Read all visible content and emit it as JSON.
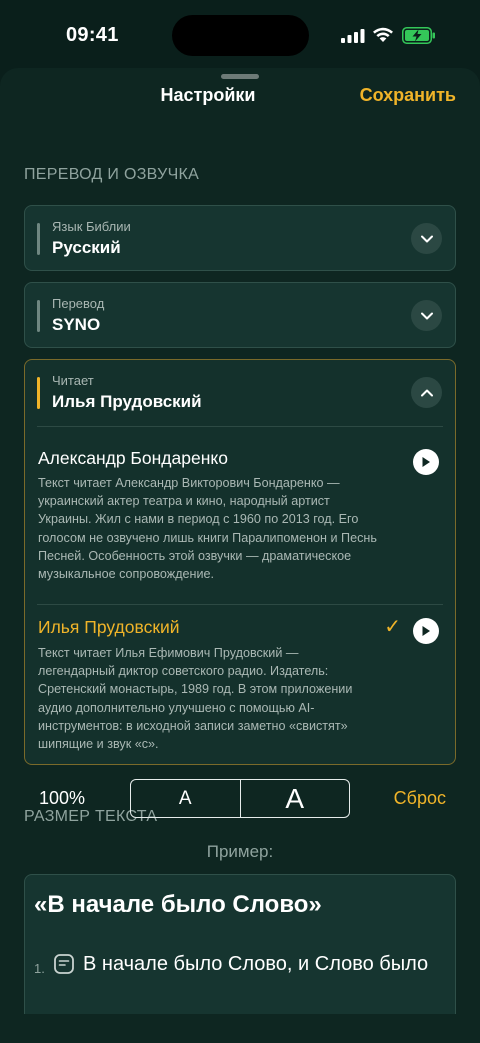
{
  "status": {
    "time": "09:41"
  },
  "header": {
    "title": "Настройки",
    "save_label": "Сохранить"
  },
  "translation_section": {
    "title": "ПЕРЕВОД И ОЗВУЧКА",
    "bible_language": {
      "label": "Язык Библии",
      "value": "Русский"
    },
    "translation": {
      "label": "Перевод",
      "value": "SYNO"
    },
    "reader": {
      "label": "Читает",
      "value": "Илья Прудовский",
      "options": [
        {
          "name": "Александр Бондаренко",
          "description": "Текст читает Александр Викторович Бондаренко — украинский актер театра и кино, народный артист Украины. Жил с нами в период с 1960 по 2013 год. Его голосом не озвучено лишь книги Паралипоменон и Песнь Песней. Особенность этой озвучки — драматическое музыкальное сопровождение.",
          "selected": false
        },
        {
          "name": "Илья Прудовский",
          "description": "Текст читает Илья Ефимович Прудовский — легендарный диктор советского радио. Издатель: Сретенский монастырь, 1989 год. В этом приложении аудио дополнительно улучшено с помощью AI-инструментов: в исходной записи заметно «свистят» шипящие и звук «с».",
          "selected": true
        }
      ]
    }
  },
  "text_size_section": {
    "title": "РАЗМЕР ТЕКСТА",
    "percent": "100%",
    "small_label": "A",
    "large_label": "A",
    "reset_label": "Сброс",
    "example_label": "Пример:"
  },
  "sample": {
    "title": "«В начале было Слово»",
    "verse_number": "1.",
    "verse_text": "В начале было Слово, и Слово было"
  },
  "colors": {
    "accent": "#f0b429",
    "background": "#0e2621",
    "card": "#163530"
  }
}
